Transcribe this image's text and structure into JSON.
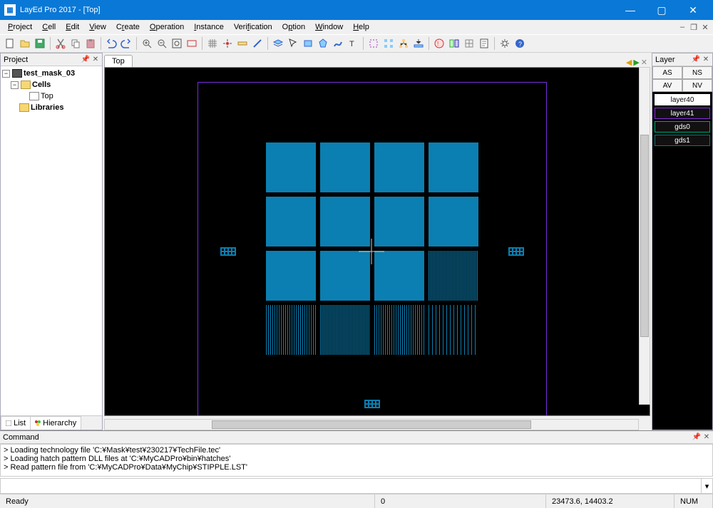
{
  "window": {
    "title": "LayEd Pro 2017 - [Top]"
  },
  "menu": {
    "items": [
      "Project",
      "Cell",
      "Edit",
      "View",
      "Create",
      "Operation",
      "Instance",
      "Verification",
      "Option",
      "Window",
      "Help"
    ]
  },
  "project_panel": {
    "title": "Project",
    "tree": {
      "root": "test_mask_03",
      "cells": "Cells",
      "top": "Top",
      "libraries": "Libraries"
    },
    "tabs": {
      "list": "List",
      "hierarchy": "Hierarchy"
    }
  },
  "doc_tabs": {
    "active": "Top"
  },
  "layer_panel": {
    "title": "Layer",
    "buttons": {
      "as": "AS",
      "ns": "NS",
      "av": "AV",
      "nv": "NV"
    },
    "items": [
      {
        "name": "layer40",
        "color": "#ffffff",
        "selected": true
      },
      {
        "name": "layer41",
        "color": "#8a2be2",
        "selected": false
      },
      {
        "name": "gds0",
        "color": "#00a86b",
        "selected": false
      },
      {
        "name": "gds1",
        "color": "#1e6e6e",
        "selected": false
      }
    ]
  },
  "command_panel": {
    "title": "Command",
    "log": [
      "> Loading technology file 'C:¥Mask¥test¥230217¥TechFile.tec'",
      "> Loading hatch pattern DLL files at 'C:¥MyCADPro¥bin¥hatches'",
      "> Read pattern file from 'C:¥MyCADPro¥Data¥MyChip¥STIPPLE.LST'"
    ],
    "input": ""
  },
  "statusbar": {
    "ready": "Ready",
    "zero": "0",
    "coords": "23473.6, 14403.2",
    "num": "NUM"
  }
}
